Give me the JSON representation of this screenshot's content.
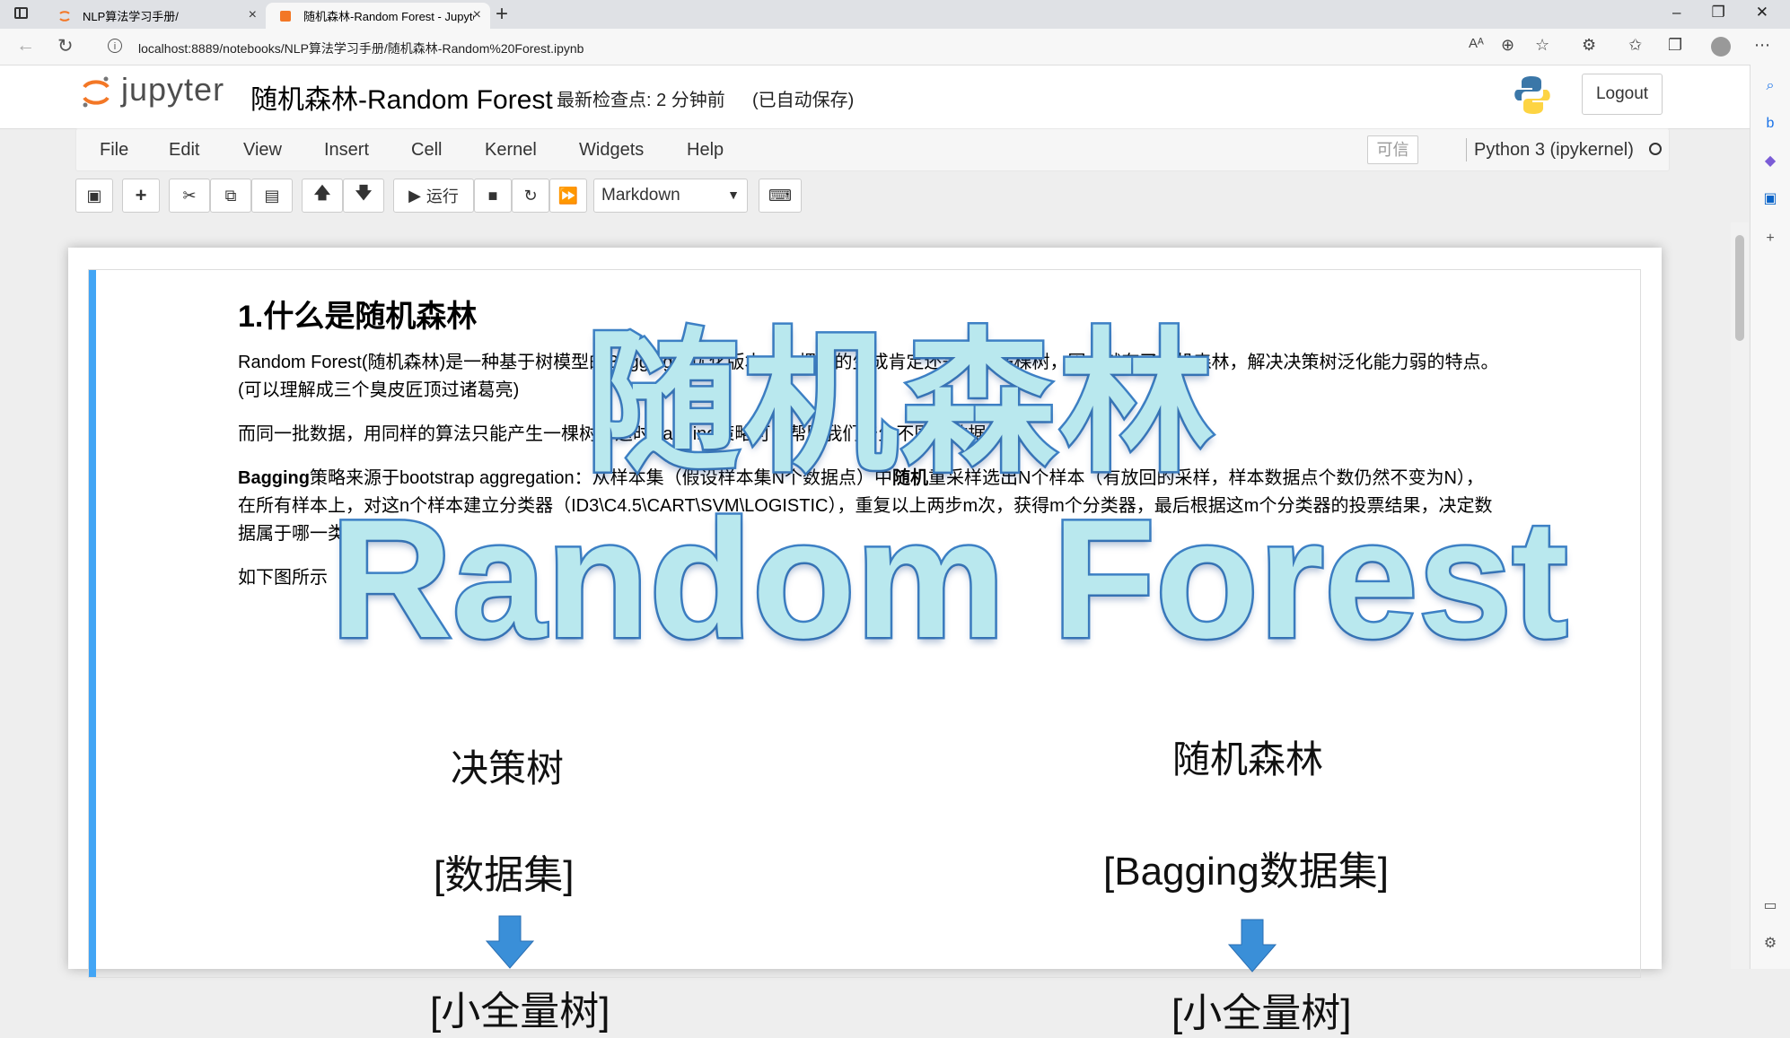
{
  "browser": {
    "tabs": [
      {
        "title": "NLP算法学习手册/",
        "close": "×"
      },
      {
        "title": "随机森林-Random Forest - Jupyter",
        "close": "×"
      }
    ],
    "new_tab": "+",
    "url": "localhost:8889/notebooks/NLP算法学习手册/随机森林-Random%20Forest.ipynb",
    "window_controls": [
      "–",
      "❐",
      "✕"
    ]
  },
  "jupyter": {
    "logo_text": "jupyter",
    "notebook_title": "随机森林-Random Forest",
    "checkpoint": "最新检查点: 2 分钟前",
    "autosave": "(已自动保存)",
    "logout": "Logout",
    "menu": [
      "File",
      "Edit",
      "View",
      "Insert",
      "Cell",
      "Kernel",
      "Widgets",
      "Help"
    ],
    "trusted": "可信",
    "kernel": "Python 3 (ipykernel)",
    "toolbar": {
      "run_label": "运行",
      "cell_type": "Markdown"
    }
  },
  "content": {
    "heading": "1.什么是随机森林",
    "para1_line1": "Random Forest(随机森林)是一种基于树模型的Bagging的优化版本，一棵树的生成肯定还是不如多棵树，因此就有了随机森林，解决决策树泛化能力弱的特点。",
    "para1_line2": "(可以理解成三个臭皮匠顶过诸葛亮)",
    "para2": "而同一批数据，用同样的算法只能产生一棵树，这时Bagging策略可以帮助我们产生不同的数据集。",
    "para3_bold1": "Bagging",
    "para3_text1": "策略来源于bootstrap aggregation：从样本集（假设样本集N个数据点）中",
    "para3_bold2": "随机",
    "para3_text2": "重采样选出N个样本（有放回的采样，样本数据点个数仍然不变为N），",
    "para3_line2": "在所有样本上，对这n个样本建立分类器（ID3\\C4.5\\CART\\SVM\\LOGISTIC），重复以上两步m次，获得m个分类器，最后根据这m个分类器的投票结果，决定数",
    "para3_line3": "据属于哪一类",
    "para4": "如下图所示"
  },
  "diagram": {
    "left_title": "决策树",
    "right_title": "随机森林",
    "left_dataset": "[数据集]",
    "right_dataset": "[Bagging数据集]",
    "left_next": "[小全量树]",
    "right_next": "[小全量树]",
    "arrow_color": "#3a8fd8"
  },
  "overlay": {
    "cn": "随机森林",
    "en": "Random Forest"
  }
}
